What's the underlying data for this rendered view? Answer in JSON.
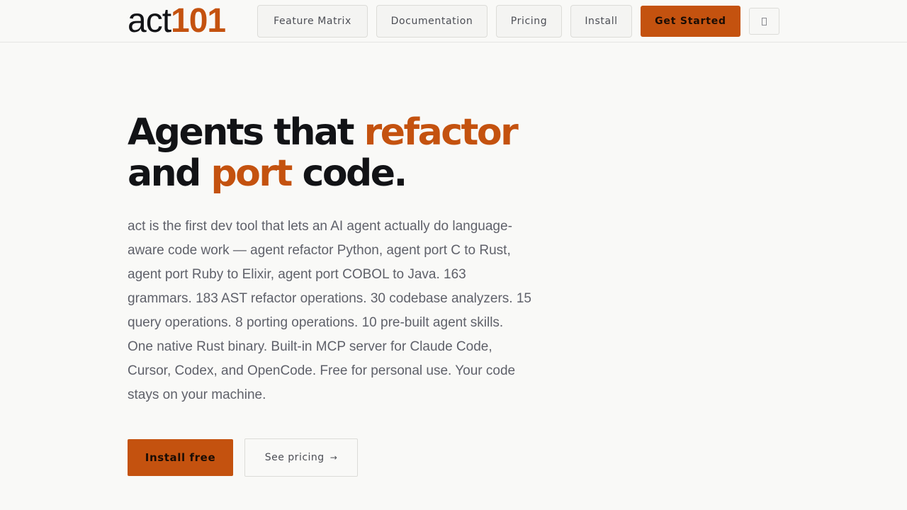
{
  "header": {
    "logo_text": "act",
    "logo_number": "101",
    "nav": [
      {
        "label": "Feature Matrix"
      },
      {
        "label": "Documentation"
      },
      {
        "label": "Pricing"
      },
      {
        "label": "Install"
      }
    ],
    "cta_label": "Get Started",
    "theme_toggle_icon": "theme-toggle-icon"
  },
  "hero": {
    "title": {
      "part1": "Agents that ",
      "accent1": "refactor",
      "part2": "and ",
      "accent2": "port",
      "part3": " code."
    },
    "description": "act is the first dev tool that lets an AI agent actually do language-aware code work — agent refactor Python, agent port C to Rust, agent port Ruby to Elixir, agent port COBOL to Java. 163 grammars. 183 AST refactor operations. 30 codebase analyzers. 15 query operations. 8 porting operations. 10 pre-built agent skills. One native Rust binary. Built-in MCP server for Claude Code, Cursor, Codex, and OpenCode. Free for personal use. Your code stays on your machine.",
    "install_label": "Install free",
    "pricing_label": "See pricing",
    "pricing_arrow": "→"
  },
  "colors": {
    "accent": "#c4520f",
    "background": "#f9f9f7",
    "text": "#121316",
    "muted_text": "#5f616a"
  }
}
